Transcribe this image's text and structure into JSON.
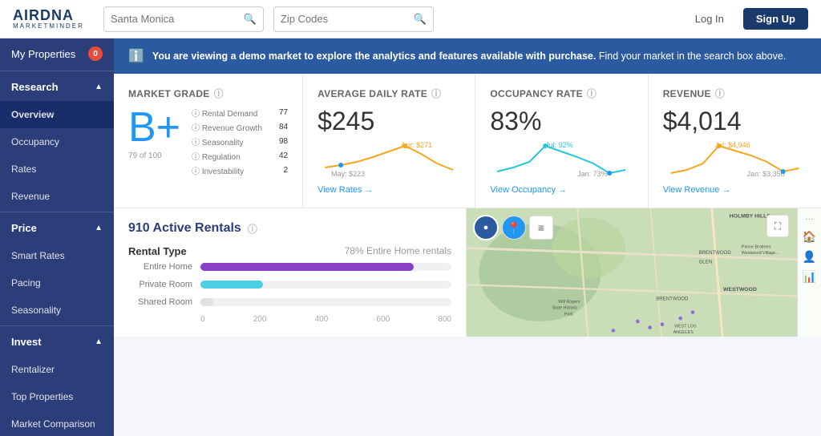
{
  "app": {
    "logo_top": "AIRDNA",
    "logo_bottom": "MARKETMINDER"
  },
  "nav": {
    "search_placeholder": "Santa Monica",
    "zip_placeholder": "Zip Codes",
    "login_label": "Log In",
    "signup_label": "Sign Up"
  },
  "sidebar": {
    "my_properties": "My Properties",
    "my_properties_badge": "0",
    "research": "Research",
    "overview": "Overview",
    "occupancy": "Occupancy",
    "rates": "Rates",
    "revenue": "Revenue",
    "price": "Price",
    "smart_rates": "Smart Rates",
    "pacing": "Pacing",
    "seasonality": "Seasonality",
    "invest": "Invest",
    "rentalizer": "Rentalizer",
    "top_properties": "Top Properties",
    "market_comparison": "Market Comparison"
  },
  "banner": {
    "text_bold": "You are viewing a demo market to explore the analytics and features available with purchase.",
    "text_rest": " Find your market in the search box above."
  },
  "market_grade": {
    "title": "Market Grade",
    "grade": "B+",
    "score": "79 of 100",
    "metrics": [
      {
        "label": "Rental Demand",
        "value": 77,
        "max": 100
      },
      {
        "label": "Revenue Growth",
        "value": 84,
        "max": 100
      },
      {
        "label": "Seasonality",
        "value": 98,
        "max": 100
      },
      {
        "label": "Regulation",
        "value": 42,
        "max": 100
      },
      {
        "label": "Investability",
        "value": 2,
        "max": 100
      }
    ]
  },
  "adr": {
    "title": "Average Daily Rate",
    "value": "$245",
    "high_label": "Apr: $271",
    "low_label": "May: $223",
    "link": "View Rates →"
  },
  "occupancy": {
    "title": "Occupancy Rate",
    "value": "83%",
    "high_label": "Jul: 92%",
    "low_label": "Jan: 73%",
    "link": "View Occupancy →"
  },
  "revenue": {
    "title": "Revenue",
    "value": "$4,014",
    "high_label": "Jul: $4,946",
    "low_label": "Jan: $3,350",
    "link": "View Revenue →"
  },
  "rentals": {
    "count": "910 Active Rentals",
    "rental_type_label": "Rental Type",
    "pct_label": "78% Entire Home rentals",
    "bars": [
      {
        "label": "Entire Home",
        "color": "#8b3fc8",
        "width": 85
      },
      {
        "label": "Private Room",
        "color": "#4dd0e1",
        "width": 25
      },
      {
        "label": "Shared Room",
        "color": "#d0d0d0",
        "width": 5
      }
    ],
    "axis_labels": [
      "0",
      "200",
      "400",
      "600",
      "800"
    ]
  }
}
